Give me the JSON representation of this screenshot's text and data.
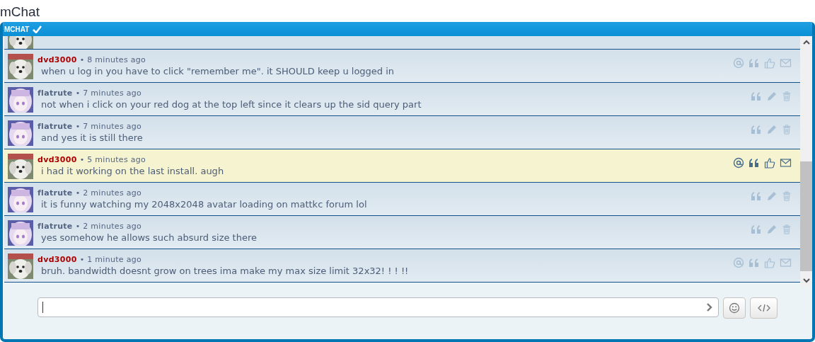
{
  "page_title": "mChat",
  "panel": {
    "title": "MCHAT"
  },
  "messages": [
    {
      "author": "dvd3000",
      "color": "#aa0000",
      "time": "• 8 minutes ago",
      "text": "when u log in you have to click \"remember me\". it SHOULD keep u logged in",
      "own": false,
      "highlighted": false
    },
    {
      "author": "flatrute",
      "color": "#536482",
      "time": "• 7 minutes ago",
      "text": "not when i click on your red dog at the top left since it clears up the sid query part",
      "own": true,
      "highlighted": false
    },
    {
      "author": "flatrute",
      "color": "#536482",
      "time": "• 7 minutes ago",
      "text": "and yes it is still there",
      "own": true,
      "highlighted": false
    },
    {
      "author": "dvd3000",
      "color": "#aa0000",
      "time": "• 5 minutes ago",
      "text": "i had it working on the last install. augh",
      "own": false,
      "highlighted": true
    },
    {
      "author": "flatrute",
      "color": "#536482",
      "time": "• 2 minutes ago",
      "text": "it is funny watching my 2048x2048 avatar loading on mattkc forum lol",
      "own": true,
      "highlighted": false
    },
    {
      "author": "flatrute",
      "color": "#536482",
      "time": "• 2 minutes ago",
      "text": "yes somehow he allows such absurd size there",
      "own": true,
      "highlighted": false
    },
    {
      "author": "dvd3000",
      "color": "#aa0000",
      "time": "• 1 minute ago",
      "text": "bruh. bandwidth doesnt grow on trees ima make my max size limit 32x32! ! ! !!",
      "own": false,
      "highlighted": false
    }
  ]
}
